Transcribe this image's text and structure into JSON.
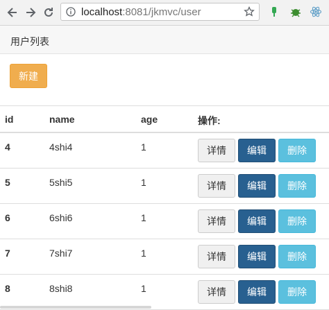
{
  "browser": {
    "url_host": "localhost",
    "url_rest": ":8081/jkmvc/user"
  },
  "page": {
    "title": "用户列表",
    "create_label": "新建"
  },
  "table": {
    "headers": [
      "id",
      "name",
      "age",
      "操作:"
    ],
    "rows": [
      {
        "id": "4",
        "name": "4shi4",
        "age": "1"
      },
      {
        "id": "5",
        "name": "5shi5",
        "age": "1"
      },
      {
        "id": "6",
        "name": "6shi6",
        "age": "1"
      },
      {
        "id": "7",
        "name": "7shi7",
        "age": "1"
      },
      {
        "id": "8",
        "name": "8shi8",
        "age": "1"
      }
    ],
    "actions": {
      "detail": "详情",
      "edit": "编辑",
      "delete": "删除"
    }
  },
  "colors": {
    "create": "#f0ad4e",
    "edit": "#286090",
    "delete": "#5bc0de"
  }
}
